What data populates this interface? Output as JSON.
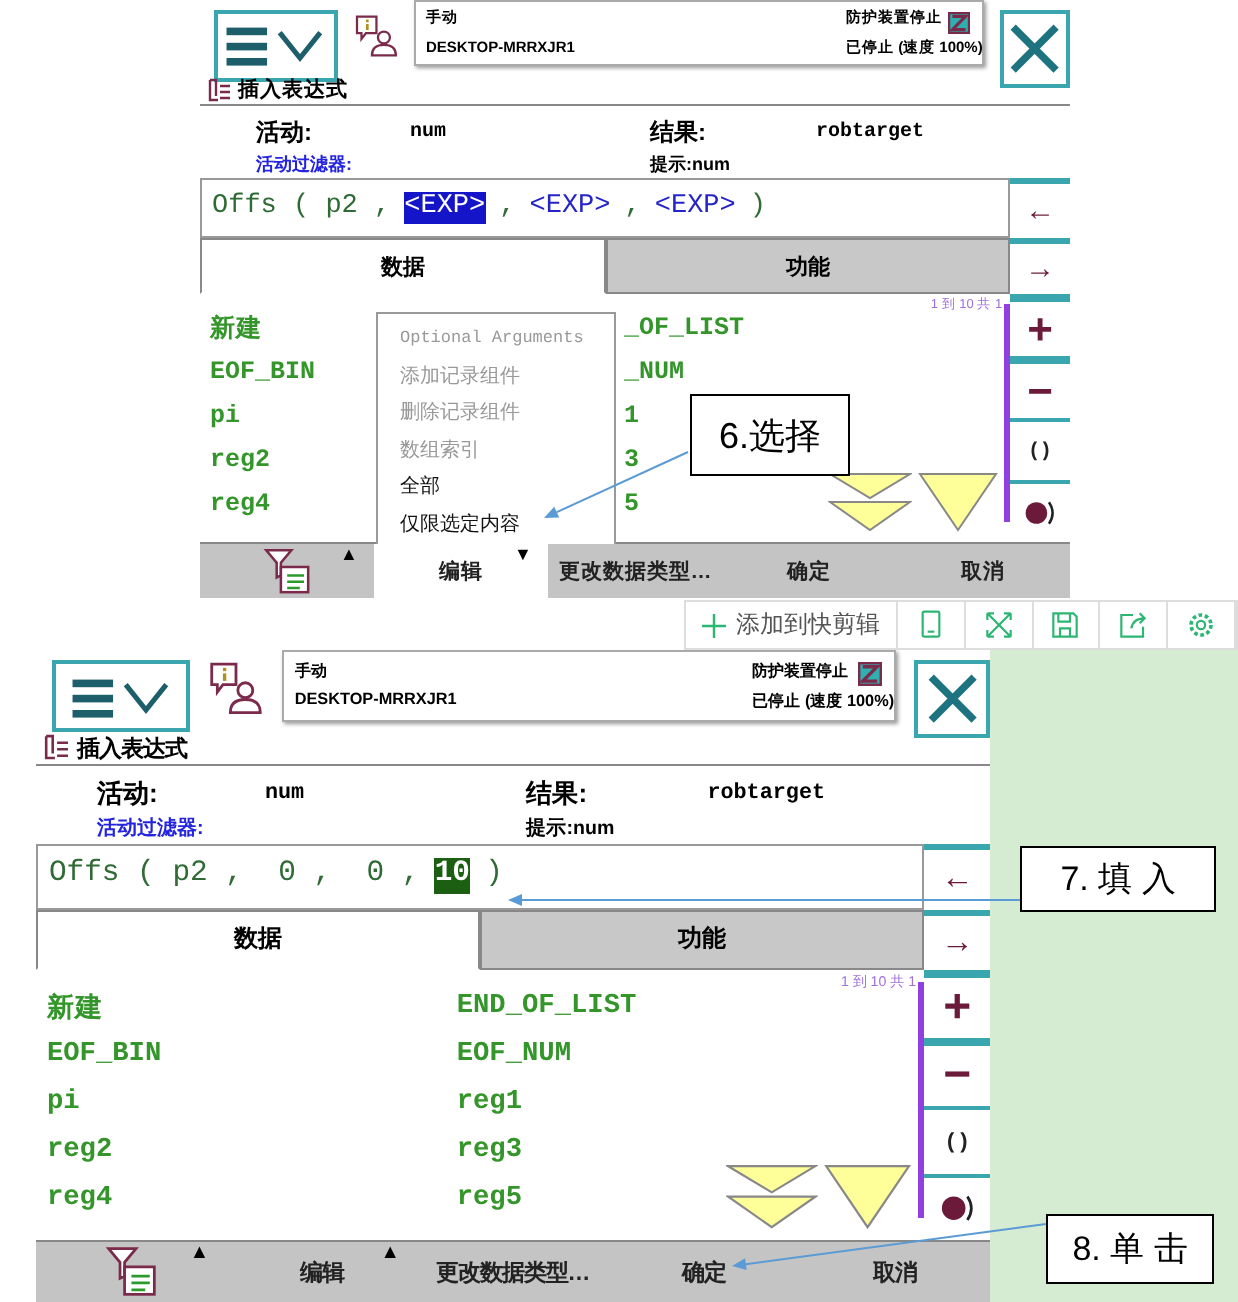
{
  "screens": [
    {
      "status": {
        "mode": "手动",
        "host": "DESKTOP-MRRXJR1",
        "safety": "防护装置停止",
        "run_state": "已停止 (速度 100%)"
      },
      "title": "插入表达式",
      "info": {
        "active_label": "活动:",
        "active_value": "num",
        "result_label": "结果:",
        "result_value": "robtarget",
        "filter_label": "活动过滤器:",
        "hint": "提示:num"
      },
      "expression": [
        {
          "kind": "code",
          "text": "Offs ( p2 ,"
        },
        {
          "kind": "placeholder",
          "text": "<EXP>",
          "selected": true
        },
        {
          "kind": "code",
          "text": ","
        },
        {
          "kind": "placeholder",
          "text": "<EXP>",
          "selected": false
        },
        {
          "kind": "code",
          "text": ","
        },
        {
          "kind": "placeholder",
          "text": "<EXP>",
          "selected": false
        },
        {
          "kind": "code",
          "text": ")"
        }
      ],
      "tabs": [
        {
          "label": "数据",
          "selected": true
        },
        {
          "label": "功能",
          "selected": false
        }
      ],
      "page_info": "1 到 10 共 1",
      "items": [
        "新建",
        "_OF_LIST",
        "EOF_BIN",
        "_NUM",
        "pi",
        "1",
        "reg2",
        "3",
        "reg4",
        "5"
      ],
      "menu": [
        {
          "label": "Optional Arguments",
          "kind": "mono",
          "disabled": true
        },
        {
          "label": "添加记录组件",
          "kind": "text",
          "disabled": true
        },
        {
          "label": "删除记录组件",
          "kind": "text",
          "disabled": true
        },
        {
          "label": "数组索引",
          "kind": "text",
          "disabled": true
        },
        {
          "label": "全部",
          "kind": "text",
          "disabled": false
        },
        {
          "label": "仅限选定内容",
          "kind": "text",
          "disabled": false
        }
      ],
      "side_buttons": [
        {
          "kind": "text",
          "label": "←"
        },
        {
          "kind": "text",
          "label": "→"
        },
        {
          "kind": "text",
          "label": "+"
        },
        {
          "kind": "text",
          "label": "−"
        },
        {
          "kind": "text",
          "label": "( )"
        },
        {
          "kind": "record"
        }
      ],
      "bottom_bar": [
        {
          "kind": "filter",
          "caret": "▲"
        },
        {
          "kind": "label",
          "label": "编辑",
          "selected": true,
          "caret": "▼"
        },
        {
          "kind": "label",
          "label": "更改数据类型…",
          "selected": false
        },
        {
          "kind": "label",
          "label": "确定",
          "selected": false
        },
        {
          "kind": "label",
          "label": "取消",
          "selected": false
        }
      ]
    },
    {
      "status": {
        "mode": "手动",
        "host": "DESKTOP-MRRXJR1",
        "safety": "防护装置停止",
        "run_state": "已停止 (速度 100%)"
      },
      "title": "插入表达式",
      "info": {
        "active_label": "活动:",
        "active_value": "num",
        "result_label": "结果:",
        "result_value": "robtarget",
        "filter_label": "活动过滤器:",
        "hint": "提示:num"
      },
      "expression": [
        {
          "kind": "code",
          "text": "Offs ( p2 ,  0 ,  0 ,"
        },
        {
          "kind": "value",
          "text": "10",
          "selected": true
        },
        {
          "kind": "code",
          "text": ")"
        }
      ],
      "tabs": [
        {
          "label": "数据",
          "selected": true
        },
        {
          "label": "功能",
          "selected": false
        }
      ],
      "page_info": "1 到 10 共 1",
      "items": [
        "新建",
        "END_OF_LIST",
        "EOF_BIN",
        "EOF_NUM",
        "pi",
        "reg1",
        "reg2",
        "reg3",
        "reg4",
        "reg5"
      ],
      "side_buttons": [
        {
          "kind": "text",
          "label": "←"
        },
        {
          "kind": "text",
          "label": "→"
        },
        {
          "kind": "text",
          "label": "+"
        },
        {
          "kind": "text",
          "label": "−"
        },
        {
          "kind": "text",
          "label": "( )"
        },
        {
          "kind": "record"
        }
      ],
      "bottom_bar": [
        {
          "kind": "filter",
          "caret": "▲"
        },
        {
          "kind": "label",
          "label": "编辑",
          "selected": false,
          "caret": "▲"
        },
        {
          "kind": "label",
          "label": "更改数据类型…",
          "selected": false
        },
        {
          "kind": "label",
          "label": "确定",
          "selected": false
        },
        {
          "kind": "label",
          "label": "取消",
          "selected": false
        }
      ]
    }
  ],
  "clip_toolbar": {
    "add_label": "添加到快剪辑"
  },
  "callouts": [
    {
      "text": "6.选择"
    },
    {
      "text": "7. 填 入"
    },
    {
      "text": "8. 单 击"
    }
  ]
}
